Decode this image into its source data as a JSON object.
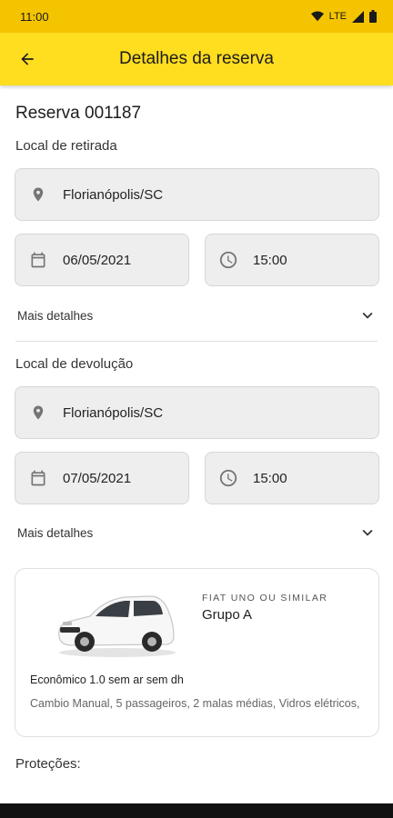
{
  "status_bar": {
    "time": "11:00",
    "network": "LTE"
  },
  "app_bar": {
    "title": "Detalhes da reserva"
  },
  "reservation": {
    "title": "Reserva 001187"
  },
  "pickup": {
    "section_label": "Local de retirada",
    "location": "Florianópolis/SC",
    "date": "06/05/2021",
    "time": "15:00",
    "more_label": "Mais detalhes"
  },
  "return": {
    "section_label": "Local de devolução",
    "location": "Florianópolis/SC",
    "date": "07/05/2021",
    "time": "15:00",
    "more_label": "Mais detalhes"
  },
  "car": {
    "brand": "FIAT UNO OU SIMILAR",
    "group": "Grupo A",
    "category": "Econômico 1.0 sem ar sem dh",
    "description": "Cambio Manual, 5 passageiros, 2 malas médias, Vidros elétricos,"
  },
  "protections": {
    "label": "Proteções:"
  },
  "colors": {
    "status_bar": "#f5c400",
    "app_bar": "#ffdd1f",
    "field_bg": "#eeeeee"
  },
  "icons": [
    "arrow-back",
    "location-pin",
    "calendar",
    "clock",
    "chevron-down",
    "wifi",
    "signal",
    "battery"
  ]
}
